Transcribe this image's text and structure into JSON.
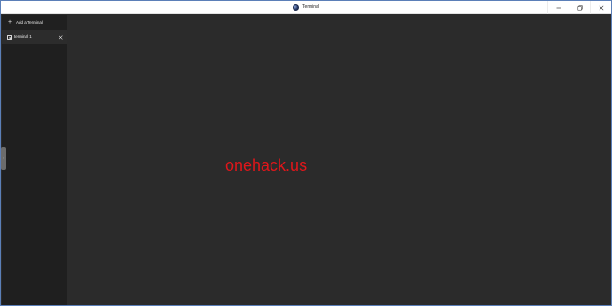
{
  "window": {
    "title": "Terminal",
    "icon": "app-globe-icon",
    "controls": {
      "minimize_icon": "minimize-icon",
      "maximize_icon": "restore-icon",
      "close_icon": "close-icon"
    }
  },
  "sidebar": {
    "add_terminal": {
      "icon": "plus-icon",
      "label": "Add a Terminal"
    },
    "tabs": [
      {
        "label": "terminal 1",
        "icon": "terminal-icon",
        "close_icon": "close-icon",
        "selected": true
      }
    ],
    "collapse_handle_icon": "chevron-right-icon"
  },
  "main": {
    "watermark_text": "onehack.us",
    "watermark_color": "#e0161a"
  },
  "colors": {
    "sidebar_bg": "#1f1f1f",
    "main_bg": "#2b2b2b",
    "tab_selected_bg": "#2c2c2c",
    "titlebar_bg": "#ffffff"
  }
}
